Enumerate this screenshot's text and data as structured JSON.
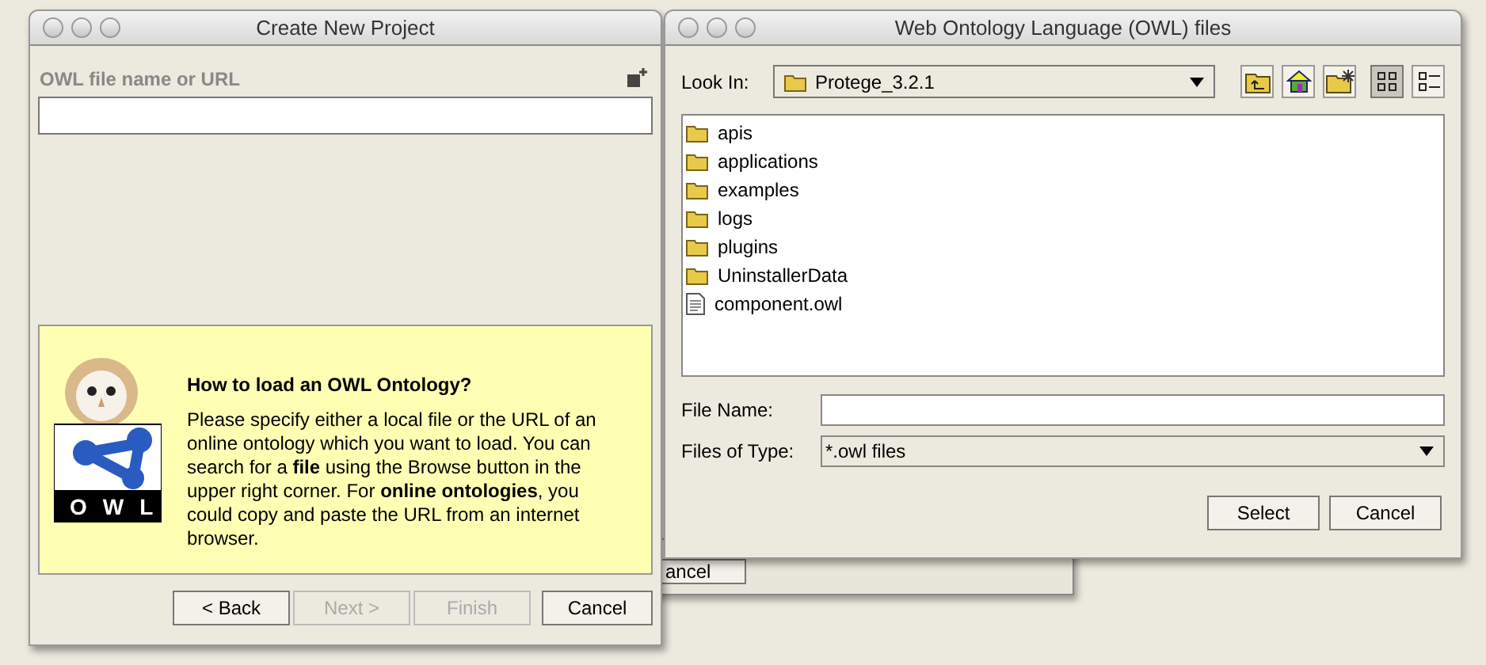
{
  "project_dialog": {
    "title": "Create New Project",
    "field_label": "OWL file name or URL",
    "help": {
      "logo_text": "OWL",
      "heading": "How to load an OWL Ontology?",
      "body": "Please specify either a local file or the URL of an online ontology which you want to load. You can search for a **file** using the Browse button in the upper right corner. For **online ontologies**, you could copy and paste the URL from an internet browser."
    },
    "buttons": [
      {
        "label": "< Back",
        "disabled": false
      },
      {
        "label": "Next >",
        "disabled": true
      },
      {
        "label": "Finish",
        "disabled": true
      },
      {
        "label": "Cancel",
        "disabled": false
      }
    ]
  },
  "background_window": {
    "button": "ancel"
  },
  "file_dialog": {
    "title": "Web Ontology Language (OWL) files",
    "look_in": {
      "label": "Look In:",
      "value": "Protege_3.2.1"
    },
    "toolbar": [
      {
        "kind": "up",
        "selected": false
      },
      {
        "kind": "home",
        "selected": false
      },
      {
        "kind": "new-folder",
        "selected": false
      },
      {
        "kind": "list",
        "selected": true
      },
      {
        "kind": "details",
        "selected": false
      }
    ],
    "files": [
      {
        "name": "apis",
        "kind": "folder"
      },
      {
        "name": "applications",
        "kind": "folder"
      },
      {
        "name": "examples",
        "kind": "folder"
      },
      {
        "name": "logs",
        "kind": "folder"
      },
      {
        "name": "plugins",
        "kind": "folder"
      },
      {
        "name": "UninstallerData",
        "kind": "folder"
      },
      {
        "name": "component.owl",
        "kind": "file"
      }
    ],
    "file_name": {
      "label": "File Name:"
    },
    "files_of_type": {
      "label": "Files of Type:",
      "value": "*.owl files"
    },
    "buttons": [
      "Select",
      "Cancel"
    ]
  }
}
